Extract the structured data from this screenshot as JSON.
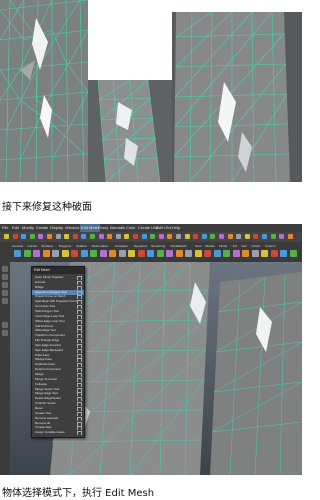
{
  "captions": {
    "first": "接下来修复这种破面",
    "second": "物体选择模式下，执行 Edit Mesh"
  },
  "maya": {
    "menus": [
      "File",
      "Edit",
      "Modify",
      "Create",
      "Display",
      "Window",
      "Edit Mesh",
      "Proxy",
      "Normals",
      "Color",
      "Create UVs",
      "Edit UVs",
      "Help"
    ],
    "active_menu": "Edit Mesh",
    "shelf_tabs": [
      "General",
      "Curves",
      "Surfaces",
      "Polygons",
      "Subdivs",
      "Deformation",
      "Animation",
      "Dynamics",
      "Rendering",
      "PaintEffects",
      "Toon",
      "Muscle",
      "Fluids",
      "Fur",
      "Hair",
      "nCloth",
      "Custom"
    ],
    "dropdown_title": "Edit Mesh",
    "dropdown_items": [
      "Keep Faces Together",
      "Extrude",
      "Bridge",
      "Append to Polygon Tool",
      "Project Curve on Mesh",
      "Split Mesh with Projected Curve",
      "Cut Faces Tool",
      "Split Polygon Tool",
      "Insert Edge Loop Tool",
      "Offset Edge Loop Tool",
      "Add Divisions",
      "Slide Edge Tool",
      "Transform Component",
      "Flip Triangle Edge",
      "Spin Edge Forward",
      "Spin Edge Backward",
      "Poke Face",
      "Wedge Face",
      "Duplicate Face",
      "Detach Component",
      "Merge",
      "Merge To Center",
      "Collapse",
      "Merge Vertex Tool",
      "Merge Edge Tool",
      "Delete Edge/Vertex",
      "Chamfer Vertex",
      "Bevel",
      "Crease Tool",
      "Remove selected",
      "Remove all",
      "Crease Sets",
      "Assign Invisible Faces"
    ],
    "highlighted_item": "Append to Polygon Tool"
  },
  "colors": {
    "wire": "#3fe0b8",
    "mesh": "#8a8d8c",
    "menu_highlight": "#5a83b0"
  }
}
